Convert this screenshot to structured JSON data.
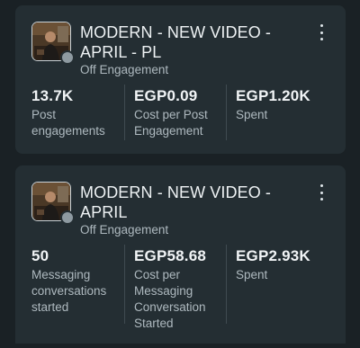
{
  "campaigns": [
    {
      "title": "MODERN - NEW VIDEO -APRIL - PL",
      "status": "Off",
      "objective": "Engagement",
      "metrics": [
        {
          "value": "13.7K",
          "label": "Post engagements"
        },
        {
          "value": "EGP0.09",
          "label": "Cost per Post Engagement"
        },
        {
          "value": "EGP1.20K",
          "label": "Spent"
        }
      ]
    },
    {
      "title": "MODERN - NEW VIDEO -APRIL",
      "status": "Off",
      "objective": "Engagement",
      "metrics": [
        {
          "value": "50",
          "label": "Messaging conversations started"
        },
        {
          "value": "EGP58.68",
          "label": "Cost per Messaging Conversation Started"
        },
        {
          "value": "EGP2.93K",
          "label": "Spent"
        }
      ]
    }
  ],
  "colors": {
    "background": "#1a2125",
    "card": "#242e33",
    "status_off": "#8e9aa1"
  },
  "icons": {
    "menu": "more-vertical-icon",
    "status": "status-dot-icon"
  }
}
